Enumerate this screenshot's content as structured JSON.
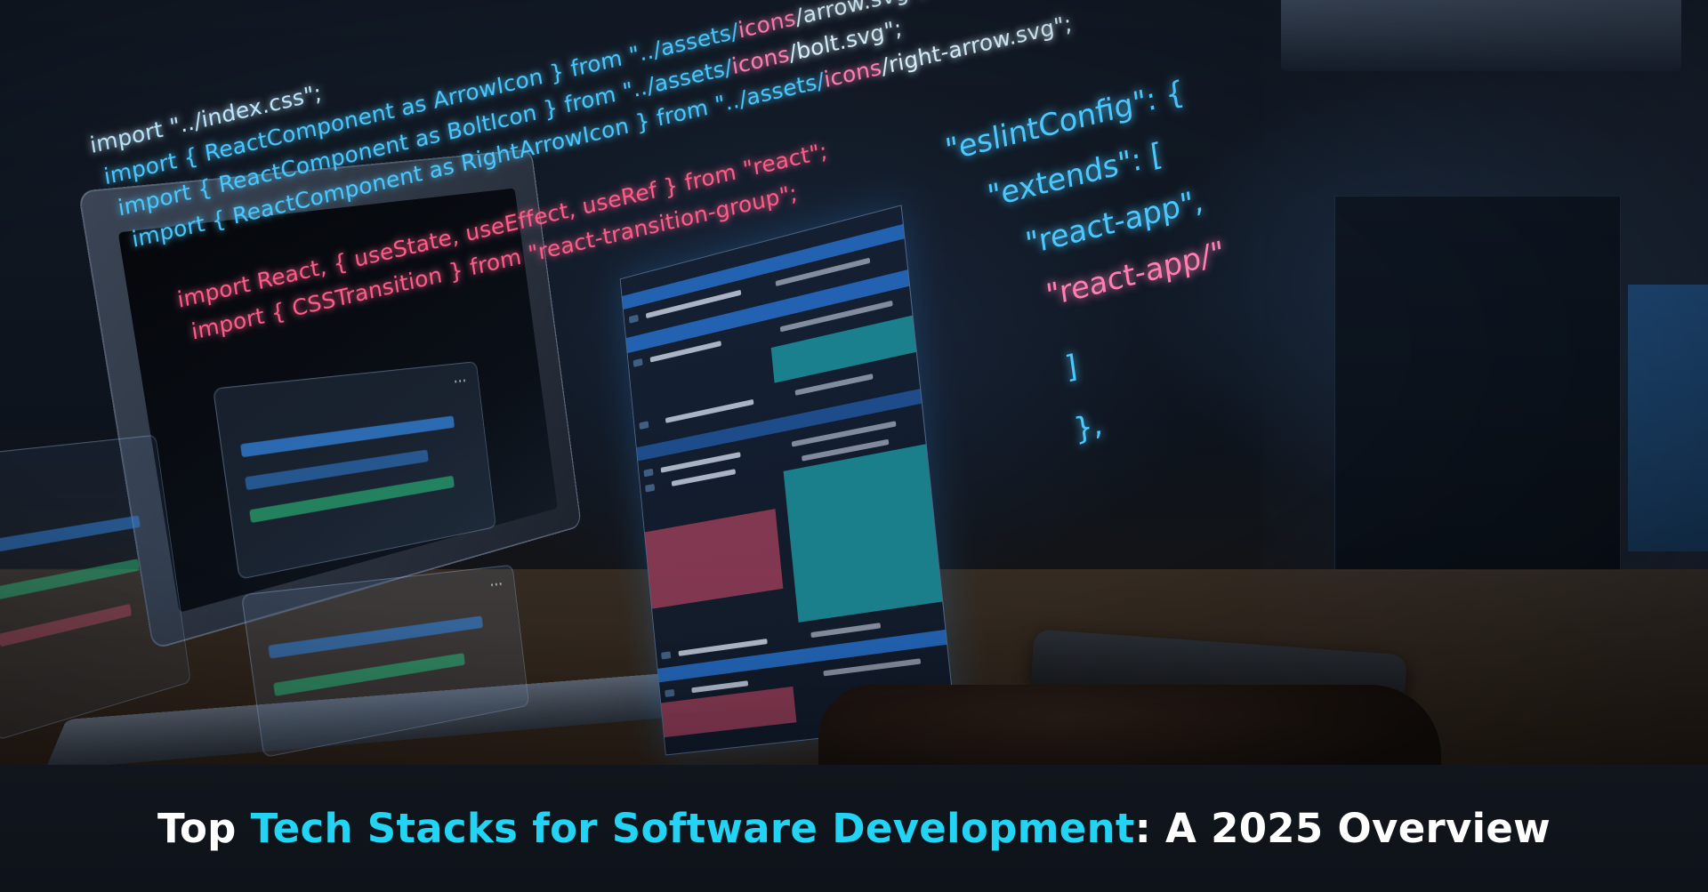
{
  "hologram_code": {
    "lines": [
      {
        "a": "import \"../index.css\";",
        "b": "",
        "c": "",
        "d": ""
      },
      {
        "a": "import { ReactComponent as ArrowIcon } from \"../assets/",
        "b": "icons",
        "c": "/arrow.svg\";",
        "d": ""
      },
      {
        "a": "import { ReactComponent as BoltIcon } from \"../assets/",
        "b": "icons",
        "c": "/bolt.svg\";",
        "d": ""
      },
      {
        "a": "import { ReactComponent as RightArrowIcon } from \"../assets/",
        "b": "icons",
        "c": "/right-arrow.svg\";",
        "d": ""
      },
      {
        "a": "import React, { useState, useEffect, useRef } from \"react\";",
        "b": "",
        "c": "",
        "d": ""
      },
      {
        "a": "import { CSSTransition } from \"react-transition-group\";",
        "b": "",
        "c": "",
        "d": ""
      }
    ],
    "config_lines": [
      "\"eslintConfig\": {",
      "\"extends\": [",
      "\"react-app\",",
      "\"react-app/\"",
      "]",
      "},"
    ]
  },
  "caption": {
    "lead": "Top ",
    "highlight": "Tech Stacks for Software Development",
    "tail": ": A 2025 Overview"
  },
  "colors": {
    "accent": "#22d3f4",
    "caption_text": "#ffffff",
    "code_cyan": "#4cc8ff",
    "code_pink": "#ff5d8a",
    "band_bg": "#0e1219"
  },
  "icons": {
    "panel_menu": "ellipsis-icon"
  }
}
